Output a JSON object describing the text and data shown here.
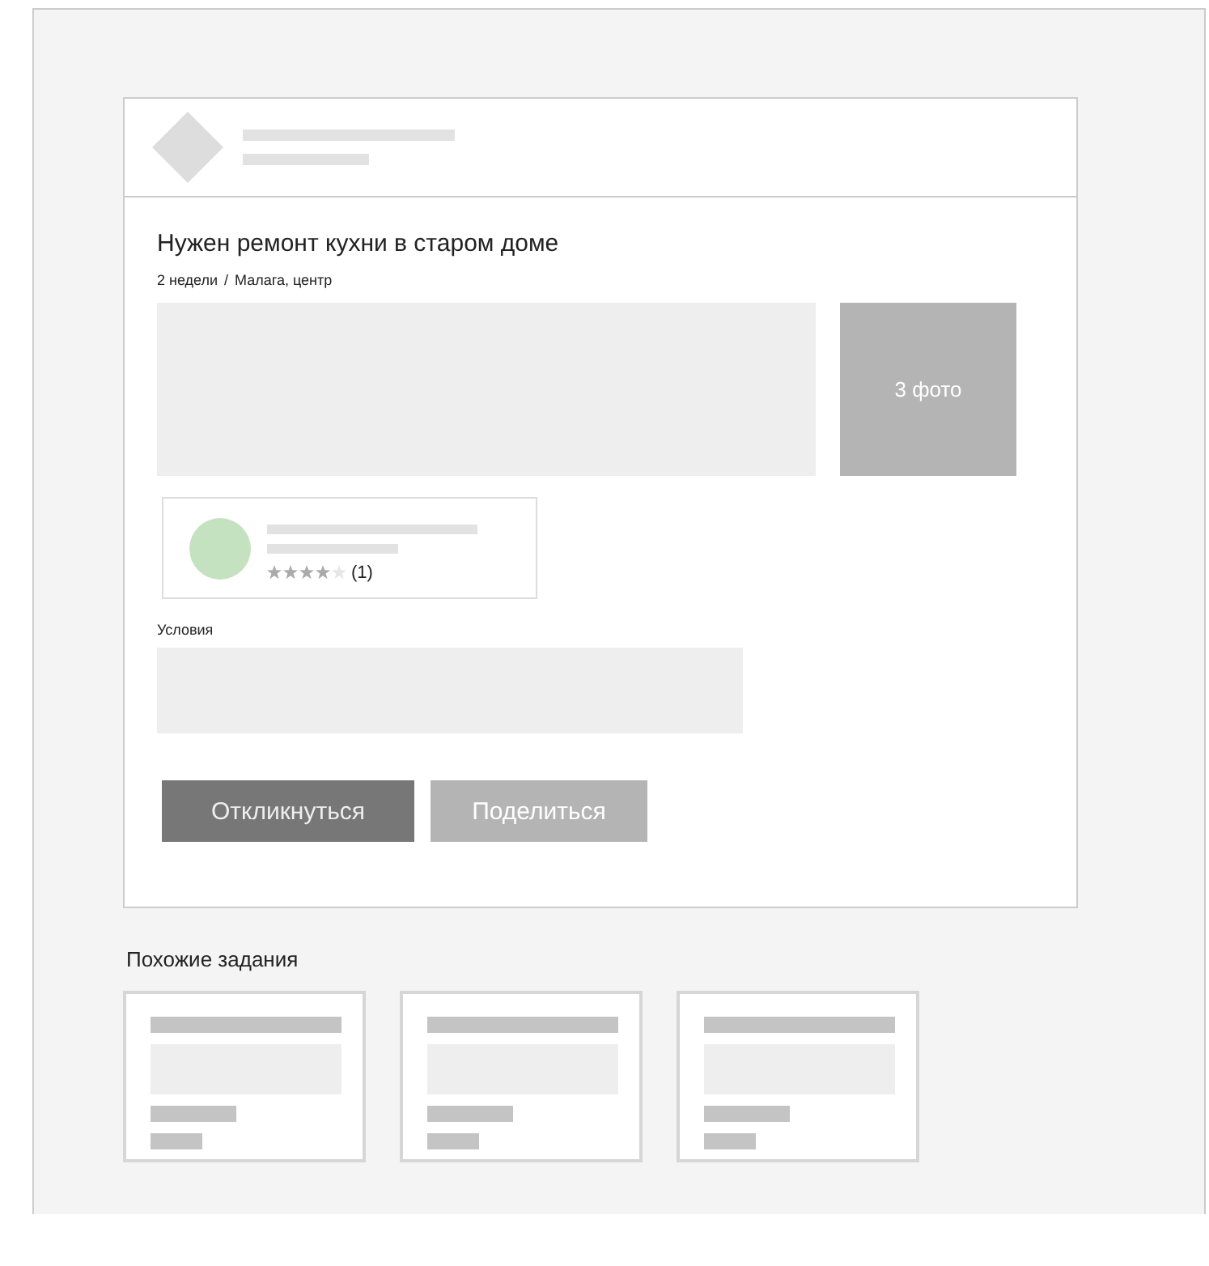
{
  "task": {
    "title": "Нужен ремонт кухни в старом доме",
    "duration": "2 недели",
    "separator": "/",
    "location": "Малага, центр",
    "photos": {
      "label": "3 фото"
    },
    "author": {
      "stars": 4,
      "reviews": "(1)"
    },
    "conditions": {
      "label": "Условия"
    },
    "buttons": [
      {
        "label": "Откликнуться",
        "disabled": false
      },
      {
        "label": "Поделиться",
        "disabled": true
      }
    ]
  },
  "similar": {
    "title": "Похожие задания",
    "cards": [
      {
        "kind": "placeholder"
      },
      {
        "kind": "placeholder"
      },
      {
        "kind": "placeholder"
      }
    ]
  }
}
